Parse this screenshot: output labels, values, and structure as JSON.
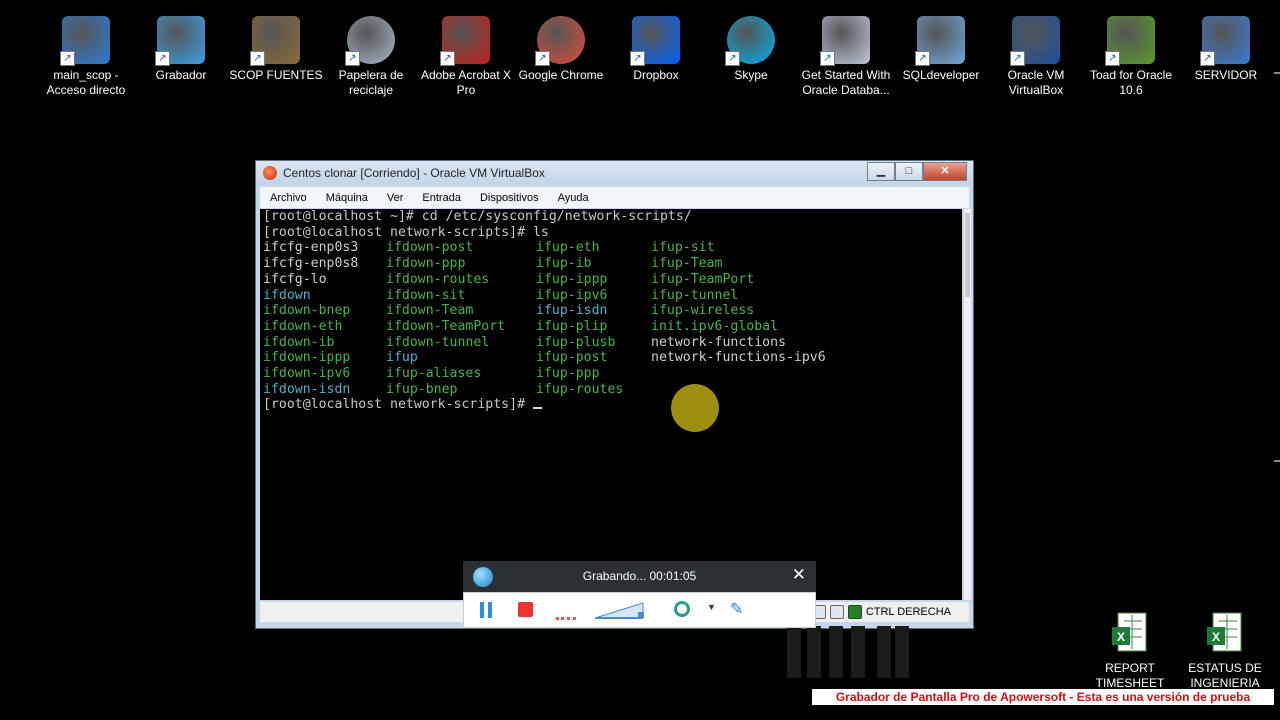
{
  "desktop": {
    "icons": [
      {
        "label": "main_scop - Acceso directo",
        "icon": "scope-shortcut-icon",
        "color": "#2b7bd4"
      },
      {
        "label": "Grabador",
        "icon": "recorder-icon",
        "color": "#3aa0e8"
      },
      {
        "label": "SCOP FUENTES",
        "icon": "folder-desk-icon",
        "color": "#8a6a3a"
      },
      {
        "label": "Papelera de reciclaje",
        "icon": "recycle-bin-icon",
        "color": "#a8b8c8"
      },
      {
        "label": "Adobe Acrobat X Pro",
        "icon": "acrobat-icon",
        "color": "#c0201a"
      },
      {
        "label": "Google Chrome",
        "icon": "chrome-icon",
        "color": "#dd4b39"
      },
      {
        "label": "Dropbox",
        "icon": "dropbox-icon",
        "color": "#0061fe"
      },
      {
        "label": "Skype",
        "icon": "skype-icon",
        "color": "#00aff0"
      },
      {
        "label": "Get Started With Oracle Databa...",
        "icon": "oracle-db-icon",
        "color": "#c0c8d8"
      },
      {
        "label": "SQLdeveloper",
        "icon": "sqldeveloper-icon",
        "color": "#6fa8dc"
      },
      {
        "label": "Oracle VM VirtualBox",
        "icon": "virtualbox-icon",
        "color": "#1c4f9c"
      },
      {
        "label": "Toad for Oracle 10.6",
        "icon": "toad-icon",
        "color": "#5a9a2a"
      },
      {
        "label": "SERVIDOR",
        "icon": "computer-icon",
        "color": "#3a7bd5"
      }
    ],
    "bottom_icons": [
      {
        "label": "REPORT TIMESHEET",
        "icon": "excel-icon"
      },
      {
        "label": "ESTATUS DE INGENIERIA",
        "icon": "excel-icon"
      }
    ]
  },
  "vbox": {
    "title": "Centos clonar [Corriendo] - Oracle VM VirtualBox",
    "menu": [
      "Archivo",
      "Máquina",
      "Ver",
      "Entrada",
      "Dispositivos",
      "Ayuda"
    ],
    "terminal": {
      "cmd1": "[root@localhost ~]# cd /etc/sysconfig/network-scripts/",
      "cmd2": "[root@localhost network-scripts]# ls",
      "columns": [
        [
          "ifcfg-enp0s3",
          "ifcfg-enp0s8",
          "ifcfg-lo",
          "ifdown",
          "ifdown-bnep",
          "ifdown-eth",
          "ifdown-ib",
          "ifdown-ippp",
          "ifdown-ipv6",
          "ifdown-isdn"
        ],
        [
          "ifdown-post",
          "ifdown-ppp",
          "ifdown-routes",
          "ifdown-sit",
          "ifdown-Team",
          "ifdown-TeamPort",
          "ifdown-tunnel",
          "ifup",
          "ifup-aliases",
          "ifup-bnep"
        ],
        [
          "ifup-eth",
          "ifup-ib",
          "ifup-ippp",
          "ifup-ipv6",
          "ifup-isdn",
          "ifup-plip",
          "ifup-plusb",
          "ifup-post",
          "ifup-ppp",
          "ifup-routes"
        ],
        [
          "ifup-sit",
          "ifup-Team",
          "ifup-TeamPort",
          "ifup-tunnel",
          "ifup-wireless",
          "init.ipv6-global",
          "network-functions",
          "network-functions-ipv6"
        ]
      ],
      "colors": [
        [
          "plain",
          "plain",
          "plain",
          "link",
          "exec",
          "exec",
          "exec",
          "exec",
          "exec",
          "link"
        ],
        [
          "exec",
          "exec",
          "exec",
          "exec",
          "exec",
          "exec",
          "exec",
          "link",
          "exec",
          "exec"
        ],
        [
          "exec",
          "exec",
          "exec",
          "exec",
          "link",
          "exec",
          "exec",
          "exec",
          "exec",
          "exec"
        ],
        [
          "exec",
          "exec",
          "exec",
          "exec",
          "exec",
          "exec",
          "plain",
          "plain"
        ]
      ],
      "prompt": "[root@localhost network-scripts]# "
    },
    "status_host_key": "CTRL DERECHA"
  },
  "recorder": {
    "status": "Grabando... 00:01:05"
  },
  "watermark": "Grabador de Pantalla Pro de Apowersoft - Esta es una versión de prueba"
}
